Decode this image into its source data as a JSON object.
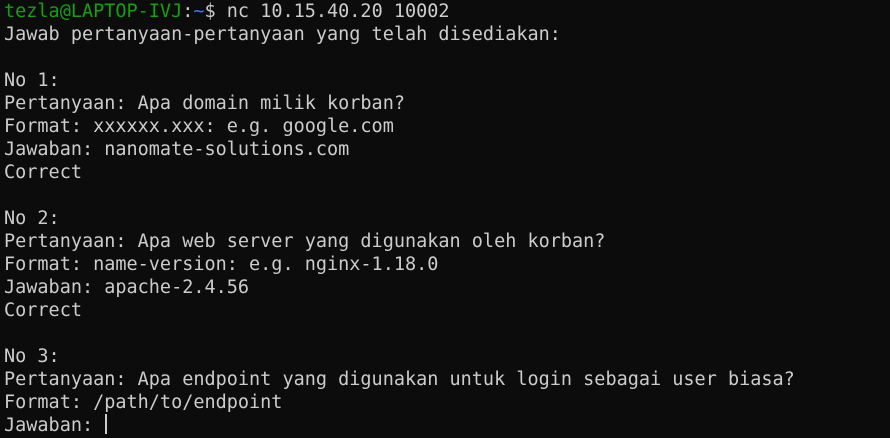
{
  "prompt": {
    "user_host": "tezla@LAPTOP-IVJ",
    "separator": ":",
    "path": "~",
    "symbol": "$ ",
    "command": "nc 10.15.40.20 10002"
  },
  "intro": "Jawab pertanyaan-pertanyaan yang telah disediakan:",
  "questions": [
    {
      "number": "No 1:",
      "question": "Pertanyaan: Apa domain milik korban?",
      "format": "Format: xxxxxx.xxx: e.g. google.com",
      "answer": "Jawaban: nanomate-solutions.com",
      "result": "Correct"
    },
    {
      "number": "No 2:",
      "question": "Pertanyaan: Apa web server yang digunakan oleh korban?",
      "format": "Format: name-version: e.g. nginx-1.18.0",
      "answer": "Jawaban: apache-2.4.56",
      "result": "Correct"
    },
    {
      "number": "No 3:",
      "question": "Pertanyaan: Apa endpoint yang digunakan untuk login sebagai user biasa?",
      "format": "Format: /path/to/endpoint",
      "answer_prompt": "Jawaban: "
    }
  ],
  "colors": {
    "background": "#0c0c0c",
    "text": "#cccccc",
    "user_host": "#13a10e",
    "path": "#3b78ff"
  }
}
